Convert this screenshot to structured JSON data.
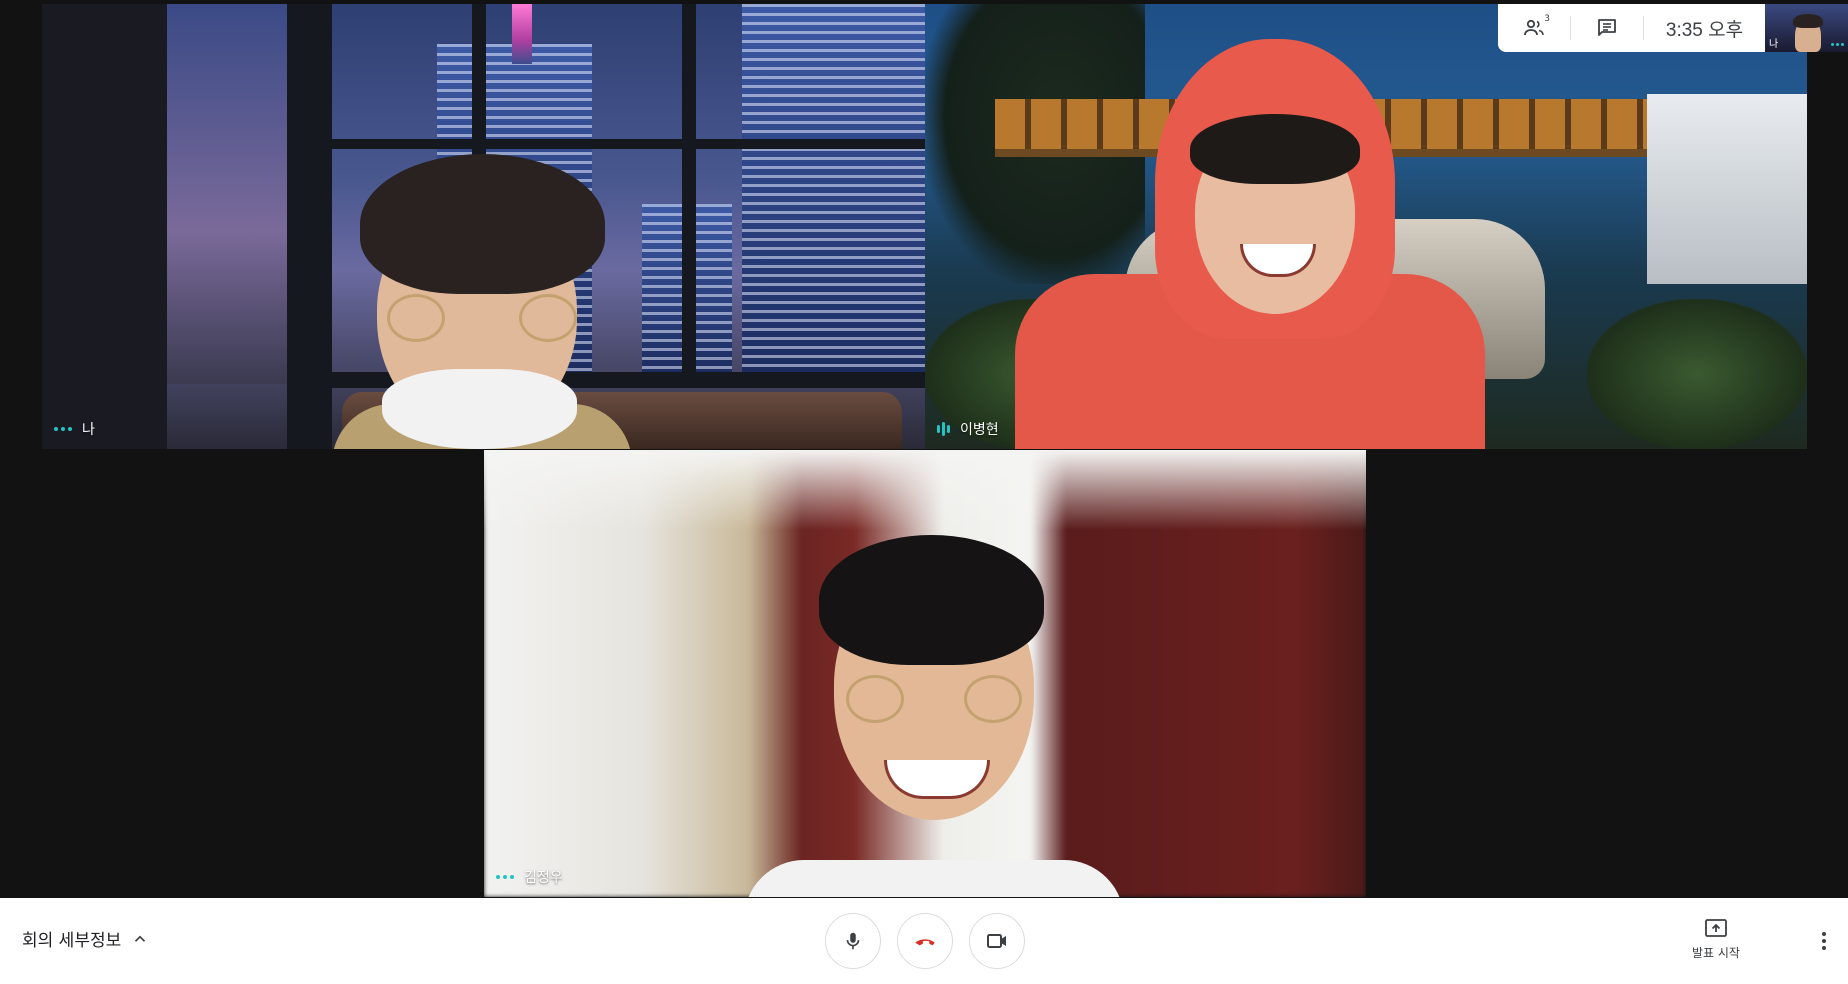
{
  "participants": [
    {
      "id": "me",
      "name": "나",
      "speaking": false
    },
    {
      "id": "lee",
      "name": "이병현",
      "speaking": true
    },
    {
      "id": "kim",
      "name": "김정우",
      "speaking": false
    }
  ],
  "top_panel": {
    "people_icon": "people-icon",
    "people_count": "3",
    "chat_icon": "chat-icon",
    "time": "3:35 오후"
  },
  "self_preview": {
    "label": "나"
  },
  "bottom_bar": {
    "meeting_details_label": "회의 세부정보",
    "meeting_details_icon": "chevron-up-icon",
    "mic_icon": "mic-icon",
    "end_call_icon": "call-end-icon",
    "camera_icon": "videocam-icon",
    "present_label": "발표 시작",
    "present_icon": "present-to-all-icon",
    "more_icon": "more-vert-icon"
  },
  "colors": {
    "accent_teal": "#23c4c4",
    "end_call_red": "#d93025",
    "toolbar_bg": "#ffffff",
    "stage_bg": "#121212"
  }
}
